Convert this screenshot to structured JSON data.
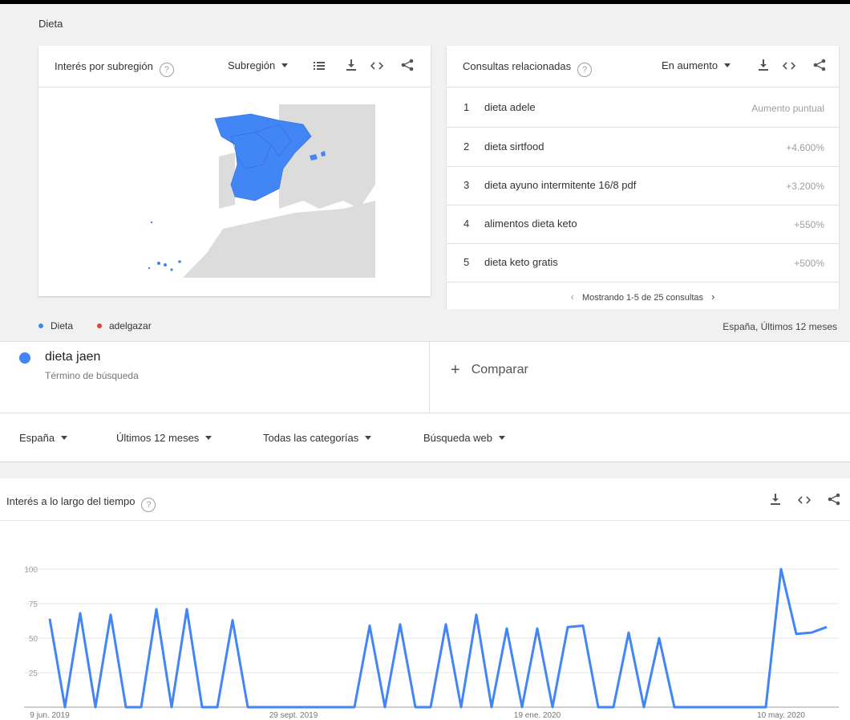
{
  "section": {
    "title": "Dieta"
  },
  "subregion_card": {
    "title": "Interés por subregión",
    "help": "?",
    "dropdown": "Subregión",
    "icons": [
      "list-icon",
      "download-icon",
      "embed-icon",
      "share-icon"
    ]
  },
  "related_card": {
    "title": "Consultas relacionadas",
    "help": "?",
    "dropdown": "En aumento",
    "icons": [
      "download-icon",
      "embed-icon",
      "share-icon"
    ],
    "rows": [
      {
        "num": "1",
        "query": "dieta adele",
        "value": "Aumento puntual"
      },
      {
        "num": "2",
        "query": "dieta sirtfood",
        "value": "+4.600%"
      },
      {
        "num": "3",
        "query": "dieta ayuno intermitente 16/8 pdf",
        "value": "+3.200%"
      },
      {
        "num": "4",
        "query": "alimentos dieta keto",
        "value": "+550%"
      },
      {
        "num": "5",
        "query": "dieta keto gratis",
        "value": "+500%"
      }
    ],
    "pager": "Mostrando 1-5 de 25 consultas"
  },
  "legend": {
    "items": [
      {
        "label": "Dieta",
        "color": "#4285f4"
      },
      {
        "label": "adelgazar",
        "color": "#db4437"
      }
    ],
    "scope": "España, Últimos 12 meses"
  },
  "term": {
    "name": "dieta jaen",
    "sub": "Término de búsqueda",
    "color": "#4285f4"
  },
  "compare": {
    "label": "Comparar",
    "plus": "+"
  },
  "filters": {
    "country": "España",
    "period": "Últimos 12 meses",
    "category": "Todas las categorías",
    "search_type": "Búsqueda web"
  },
  "interest_chart": {
    "title": "Interés a lo largo del tiempo",
    "help": "?"
  },
  "chart_data": {
    "type": "line",
    "title": "Interés a lo largo del tiempo",
    "color": "#4285f4",
    "ylim": [
      0,
      100
    ],
    "yticks": [
      25,
      50,
      75,
      100
    ],
    "xtick_labels": [
      {
        "label": "9 jun. 2019",
        "index": 0
      },
      {
        "label": "29 sept. 2019",
        "index": 16
      },
      {
        "label": "19 ene. 2020",
        "index": 32
      },
      {
        "label": "10 may. 2020",
        "index": 48
      }
    ],
    "series": [
      {
        "values": [
          64,
          0,
          68,
          0,
          67,
          0,
          0,
          71,
          0,
          71,
          0,
          0,
          63,
          0,
          0,
          0,
          0,
          0,
          0,
          0,
          0,
          59,
          0,
          60,
          0,
          0,
          60,
          0,
          67,
          0,
          57,
          0,
          57,
          0,
          58,
          59,
          0,
          0,
          54,
          0,
          50,
          0,
          0,
          0,
          0,
          0,
          0,
          0,
          100,
          53,
          54,
          58
        ]
      }
    ]
  }
}
